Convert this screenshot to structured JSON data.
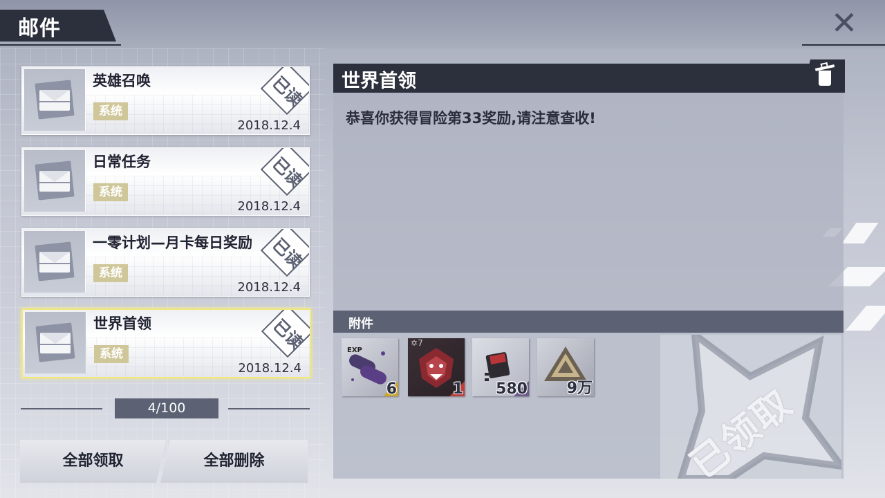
{
  "header": {
    "title": "邮件"
  },
  "mails": [
    {
      "name": "英雄召唤",
      "tag": "系统",
      "date": "2018.12.4",
      "status": "已读"
    },
    {
      "name": "日常任务",
      "tag": "系统",
      "date": "2018.12.4",
      "status": "已读"
    },
    {
      "name": "一零计划—月卡每日奖励",
      "tag": "系统",
      "date": "2018.12.4",
      "status": "已读"
    },
    {
      "name": "世界首领",
      "tag": "系统",
      "date": "2018.12.4",
      "status": "已读",
      "selected": true
    }
  ],
  "pagination": {
    "text": "4/100"
  },
  "buttons": {
    "claim_all": "全部领取",
    "delete_all": "全部删除"
  },
  "detail": {
    "title": "世界首领",
    "content": "恭喜你获得冒险第33奖励,请注意查收!",
    "attachments_label": "附件",
    "claimed_label": "已领取"
  },
  "attachments": [
    {
      "icon": "exp-capsule-icon",
      "count": "6",
      "label": "EXP"
    },
    {
      "icon": "dragon-head-icon",
      "count": "1",
      "stars": "7"
    },
    {
      "icon": "chip-module-icon",
      "count": "580"
    },
    {
      "icon": "triangle-coin-icon",
      "count": "9万"
    }
  ],
  "colors": {
    "dark": "#2c303c",
    "accent_bar": "#5c6274",
    "tag": "#cfc79a",
    "selected_border": "#f2e97a"
  }
}
